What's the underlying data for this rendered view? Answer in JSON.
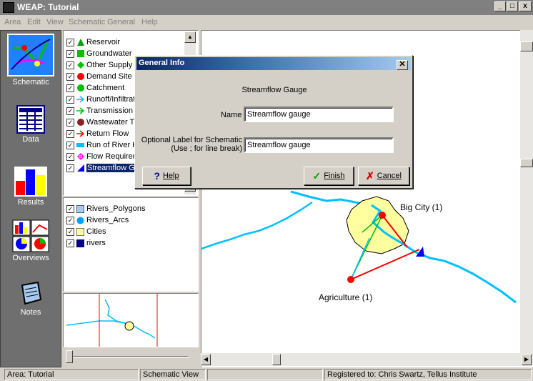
{
  "window": {
    "title": "WEAP: Tutorial",
    "controls": [
      "_",
      "□",
      "x"
    ]
  },
  "menu": [
    "Area",
    "Edit",
    "View",
    "Schematic",
    "General",
    "Help"
  ],
  "sidebar": [
    {
      "label": "Schematic",
      "icon": "schematic-icon"
    },
    {
      "label": "Data",
      "icon": "data-icon"
    },
    {
      "label": "Results",
      "icon": "results-icon"
    },
    {
      "label": "Overviews",
      "icon": "overviews-icon"
    },
    {
      "label": "Notes",
      "icon": "notes-icon"
    }
  ],
  "legend": {
    "items": [
      {
        "label": "Reservoir",
        "checked": true,
        "color": "#00a000"
      },
      {
        "label": "Groundwater",
        "checked": true,
        "color": "#00c000"
      },
      {
        "label": "Other Supply",
        "checked": true,
        "color": "#00c000"
      },
      {
        "label": "Demand Site",
        "checked": true,
        "color": "#ff0000"
      },
      {
        "label": "Catchment",
        "checked": true,
        "color": "#00c000"
      },
      {
        "label": "Runoff/Infiltrat",
        "checked": true,
        "color": "#00c0ff"
      },
      {
        "label": "Transmission L",
        "checked": true,
        "color": "#00c000"
      },
      {
        "label": "Wastewater T",
        "checked": true,
        "color": "#8b2020"
      },
      {
        "label": "Return Flow",
        "checked": true,
        "color": "#ff0000"
      },
      {
        "label": "Run of River H",
        "checked": true,
        "color": "#00c0ff"
      },
      {
        "label": "Flow Requirem",
        "checked": true,
        "color": "#ff00ff"
      },
      {
        "label": "Streamflow Ga",
        "checked": true,
        "color": "#0000ff"
      }
    ],
    "layers": [
      {
        "label": "Rivers_Polygons",
        "checked": true,
        "color": "#a6caf0"
      },
      {
        "label": "Rivers_Arcs",
        "checked": true,
        "color": "#00a0ff"
      },
      {
        "label": "Cities",
        "checked": true,
        "color": "#ffffa0"
      },
      {
        "label": "rivers",
        "checked": true,
        "color": "#000080"
      }
    ]
  },
  "map": {
    "labels": {
      "big_city": "Big City (1)",
      "agriculture": "Agriculture (1)"
    },
    "colors": {
      "river": "#00c0ff",
      "city": "#ffffa0",
      "demand": "#ff0000",
      "transmission": "#00c000"
    }
  },
  "dialog": {
    "title": "General Info",
    "heading": "Streamflow Gauge",
    "name_label": "Name",
    "name_value": "Streamflow gauge",
    "optional_label_line1": "Optional Label for Schematic",
    "optional_label_line2": "(Use ; for line break)",
    "optional_value": "Streamflow gauge",
    "help_button": "Help",
    "finish_button": "Finish",
    "cancel_button": "Cancel"
  },
  "status": {
    "area": "Area: Tutorial",
    "view": "Schematic View",
    "registered": "Registered to: Chris Swartz, Tellus Institute"
  }
}
